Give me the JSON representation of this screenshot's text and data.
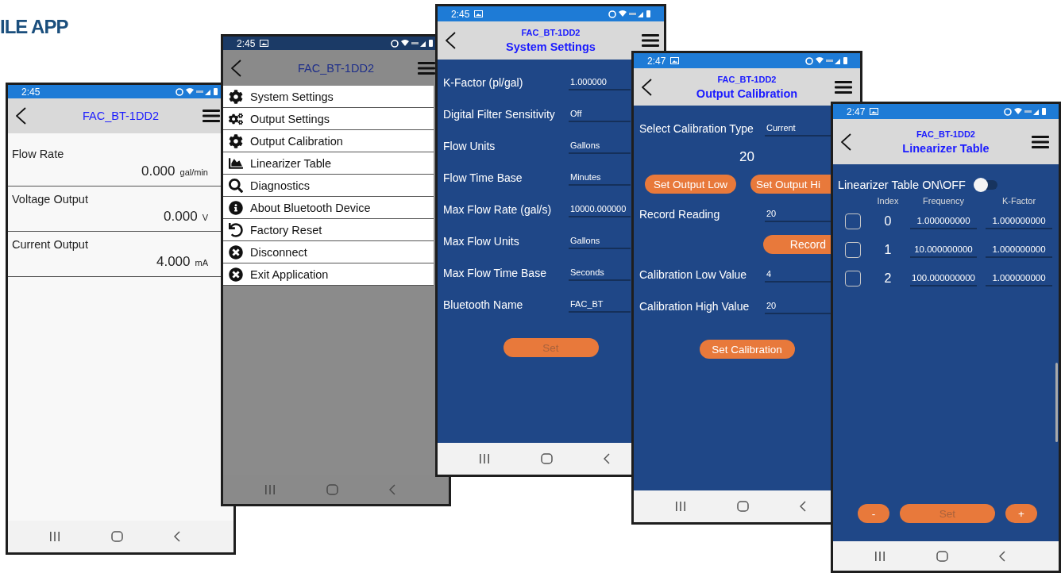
{
  "banner": {
    "title": "ILE APP"
  },
  "phones": [
    {
      "kind": "readings",
      "status": {
        "time": "2:45",
        "notification": false
      },
      "device": "FAC_BT-1DD2",
      "readings": [
        {
          "label": "Flow Rate",
          "value": "0.000",
          "unit": "gal/min"
        },
        {
          "label": "Voltage Output",
          "value": "0.000",
          "unit": "V"
        },
        {
          "label": "Current Output",
          "value": "4.000",
          "unit": "mA"
        }
      ]
    },
    {
      "kind": "menu",
      "status": {
        "time": "2:45",
        "notification": true
      },
      "device": "FAC_BT-1DD2",
      "menu_items": [
        "System Settings",
        "Output Settings",
        "Output Calibration",
        "Linearizer Table",
        "Diagnostics",
        "About Bluetooth Device",
        "Factory Reset",
        "Disconnect",
        "Exit Application"
      ]
    },
    {
      "kind": "form",
      "status": {
        "time": "2:45",
        "notification": true
      },
      "device": "FAC_BT-1DD2",
      "page_title": "System Settings",
      "items": [
        {
          "kind": "field",
          "label": "K-Factor (pl/gal)",
          "value": "1.000000"
        },
        {
          "kind": "field",
          "label": "Digital Filter Sensitivity",
          "value": "Off"
        },
        {
          "kind": "field",
          "label": "Flow Units",
          "value": "Gallons"
        },
        {
          "kind": "field",
          "label": "Flow Time Base",
          "value": "Minutes"
        },
        {
          "kind": "field",
          "label": "Max Flow Rate (gal/s)",
          "value": "10000.000000"
        },
        {
          "kind": "field",
          "label": "Max Flow Units",
          "value": "Gallons"
        },
        {
          "kind": "field",
          "label": "Max Flow Time Base",
          "value": "Seconds"
        },
        {
          "kind": "field",
          "label": "Bluetooth Name",
          "value": "FAC_BT"
        },
        {
          "kind": "button",
          "label": "Set",
          "disabled": true
        }
      ]
    },
    {
      "kind": "form",
      "status": {
        "time": "2:47",
        "notification": true
      },
      "device": "FAC_BT-1DD2",
      "page_title": "Output Calibration",
      "items": [
        {
          "kind": "field",
          "label": "Select Calibration Type",
          "value": "Current"
        },
        {
          "kind": "number",
          "value": "20"
        },
        {
          "kind": "button_pair",
          "buttons": [
            "Set Output Low",
            "Set Output Hi"
          ]
        },
        {
          "kind": "field",
          "label": "Record Reading",
          "value": "20"
        },
        {
          "kind": "side_button",
          "label": "Record"
        },
        {
          "kind": "field",
          "label": "Calibration Low Value",
          "value": "4"
        },
        {
          "kind": "field",
          "label": "Calibration High Value",
          "value": "20"
        },
        {
          "kind": "button",
          "label": "Set Calibration",
          "disabled": false
        }
      ]
    },
    {
      "kind": "table",
      "status": {
        "time": "2:47",
        "notification": true
      },
      "device": "FAC_BT-1DD2",
      "page_title": "Linearizer Table",
      "toggle": {
        "label": "Linearizer Table ON\\OFF",
        "on": false
      },
      "columns": [
        "Index",
        "Frequency",
        "K-Factor"
      ],
      "rows": [
        {
          "checked": false,
          "index": "0",
          "frequency": "1.000000000",
          "k_factor": "1.000000000"
        },
        {
          "checked": false,
          "index": "1",
          "frequency": "10.000000000",
          "k_factor": "1.000000000"
        },
        {
          "checked": false,
          "index": "2",
          "frequency": "100.000000000",
          "k_factor": "1.000000000"
        }
      ],
      "buttons": [
        {
          "label": "-",
          "disabled": false
        },
        {
          "label": "Set",
          "disabled": true
        },
        {
          "label": "+",
          "disabled": false
        }
      ]
    }
  ]
}
